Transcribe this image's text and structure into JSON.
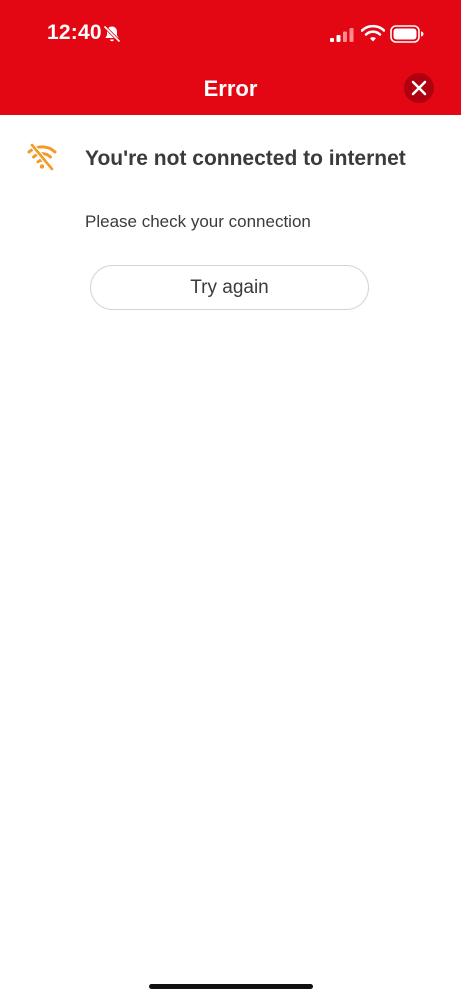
{
  "status_bar": {
    "time": "12:40",
    "icons": [
      "bell-slash-icon",
      "cellular-signal-icon",
      "wifi-icon",
      "battery-icon"
    ]
  },
  "header": {
    "title": "Error",
    "close_icon": "close-icon",
    "background_color": "#e30613"
  },
  "error": {
    "icon": "wifi-off-icon",
    "icon_color": "#f39a2a",
    "heading": "You're not connected to internet",
    "message": "Please check your connection",
    "retry_label": "Try again"
  }
}
